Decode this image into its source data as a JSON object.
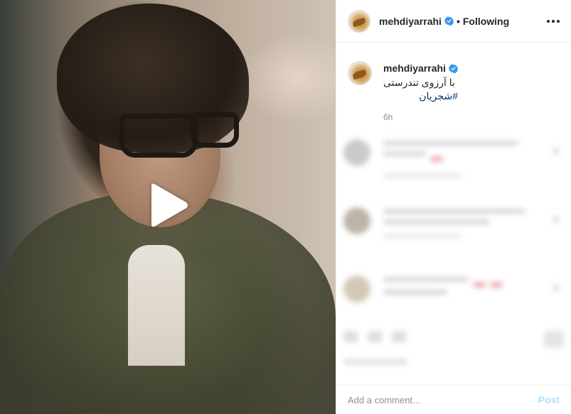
{
  "post": {
    "username": "mehdiyarrahi",
    "follow_separator": "•",
    "follow_status": "Following",
    "caption_text": "با آرزوی تندرستی",
    "caption_hashtag": "#شجریان",
    "time_ago": "6h"
  },
  "media": {
    "type": "video",
    "play_icon": "play-icon"
  },
  "comment_box": {
    "placeholder": "Add a comment...",
    "post_label": "Post"
  },
  "icons": {
    "verified": "verified-badge-icon",
    "more": "more-options-icon"
  },
  "colors": {
    "verified_blue": "#3897f0",
    "hashtag_link": "#00376b",
    "post_button_disabled": "#b2dffc",
    "muted_text": "#8e8e8e"
  }
}
